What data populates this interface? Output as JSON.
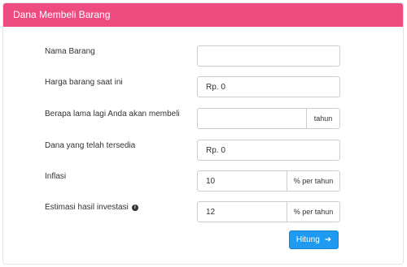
{
  "panel": {
    "title": "Dana Membeli Barang"
  },
  "form": {
    "nama_barang": {
      "label": "Nama Barang",
      "value": ""
    },
    "harga_barang": {
      "label": "Harga barang saat ini",
      "value": "Rp. 0"
    },
    "lama_membeli": {
      "label": "Berapa lama lagi Anda akan membeli",
      "value": "",
      "addon": "tahun"
    },
    "dana_tersedia": {
      "label": "Dana yang telah tersedia",
      "value": "Rp. 0"
    },
    "inflasi": {
      "label": "Inflasi",
      "value": "10",
      "addon": "% per tahun"
    },
    "estimasi": {
      "label": "Estimasi hasil investasi",
      "value": "12",
      "addon": "% per tahun",
      "info_icon": "i"
    }
  },
  "actions": {
    "submit_label": "Hitung",
    "submit_icon": "arrow-right-icon"
  },
  "colors": {
    "header": "#ee4c80",
    "button": "#1e9bf0"
  }
}
